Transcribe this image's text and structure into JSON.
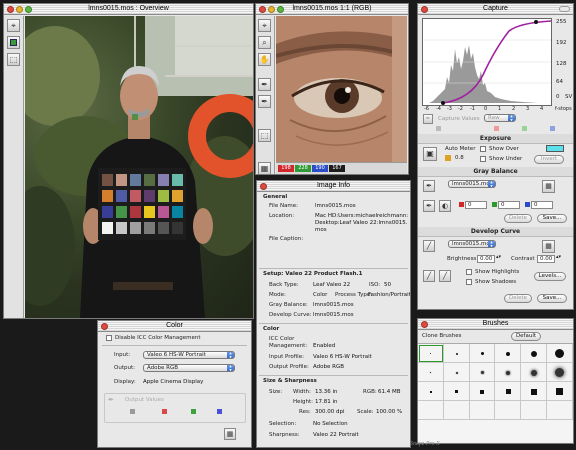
{
  "overview": {
    "title": "lmns0015.mos : Overview",
    "tools": [
      "crosshair-icon",
      "color-square-icon",
      "crop-icon"
    ]
  },
  "loupe": {
    "title": "lmns0015.mos 1:1 (RGB)",
    "rgb": {
      "r": "198",
      "g": "228",
      "b": "190",
      "extra": "167"
    },
    "tools": [
      "crosshair-icon",
      "zoom-icon",
      "hand-icon",
      "eyedropper-icon",
      "gray-eyedropper-icon",
      "crop-icon",
      "grid-icon"
    ]
  },
  "capture": {
    "title": "Capture",
    "axis_right": [
      "255",
      "192",
      "128",
      "64",
      "0"
    ],
    "sv_label": "SV",
    "axis_bottom": [
      "-6",
      "-4",
      "-3",
      "-2",
      "-1",
      "0",
      "1",
      "2",
      "3",
      "4"
    ],
    "fstops_label": "f-stops",
    "values_label": "Capture Values",
    "raw_option": "Raw"
  },
  "exposure": {
    "title": "Exposure",
    "auto_meter_label": "Auto Meter",
    "auto_meter_value": "0.8",
    "show_over_label": "Show Over",
    "show_under_label": "Show Under",
    "invert_label": "Invert",
    "over_color": "#5ce0ec"
  },
  "gray_balance": {
    "title": "Gray Balance",
    "preset": "lmns0015.mos",
    "r_value": "0",
    "g_value": "0",
    "b_value": "0",
    "delete_label": "Delete",
    "save_label": "Save..."
  },
  "develop_curve": {
    "title": "Develop Curve",
    "preset": "lmns0015.mos",
    "brightness_label": "Brightness",
    "brightness_value": "0.00",
    "contrast_label": "Contrast",
    "contrast_value": "0.00",
    "show_highlights_label": "Show Highlights",
    "show_shadows_label": "Show Shadows",
    "levels_label": "Levels...",
    "delete_label": "Delete",
    "save_label": "Save..."
  },
  "brushes": {
    "title": "Brushes",
    "clone_label": "Clone Brushes",
    "default_label": "Default"
  },
  "image_info": {
    "title": "Image Info",
    "general_header": "General",
    "file_name_label": "File Name:",
    "file_name": "lmns0015.mos",
    "location_label": "Location:",
    "location": "Mac HD:Users:michaelreichmann:Desktop:Leaf Valeo 22:lmns0015.mos",
    "caption_label": "File Caption:",
    "setup_header": "Setup:  Valeo 22 Product Flash.1",
    "back_type_label": "Back Type:",
    "back_type": "Leaf Valeo 22",
    "iso_label": "ISO:",
    "iso": "50",
    "mode_label": "Mode:",
    "mode": "Color",
    "process_label": "Process Type:",
    "process": "Fashion/Portrait",
    "gray_balance_label": "Gray Balance:",
    "gray_balance": "lmns0015.mos",
    "develop_curve_label": "Develop Curve:",
    "develop_curve": "lmns0015.mos",
    "color_header": "Color",
    "icc_label": "ICC Color Management:",
    "icc": "Enabled",
    "input_profile_label": "Input Profile:",
    "input_profile": "Valeo 6 HS-W Portrait",
    "output_profile_label": "Output Profile:",
    "output_profile": "Adobe RGB",
    "size_header": "Size & Sharpness",
    "size_label": "Size:",
    "width_label": "Width:",
    "width": "13.36 in",
    "rgb_label": "RGB:",
    "rgb": "61.4 MB",
    "height_label": "Height:",
    "height": "17.81 in",
    "res_label": "Res:",
    "res": "300.00 dpi",
    "scale_label": "Scale:",
    "scale": "100.00 %",
    "selection_label": "Selection:",
    "selection": "No Selection",
    "sharpness_label": "Sharpness:",
    "sharpness": "Valeo 22 Portrait"
  },
  "color_panel": {
    "title": "Color",
    "disable_icc_label": "Disable ICC Color Management",
    "input_label": "Input:",
    "input_value": "Valeo 6 HS-W Portrait",
    "output_label": "Output:",
    "output_value": "Adobe RGB",
    "display_label": "Display:",
    "display_value": "Apple Cinema Display",
    "output_values_label": "Output Values"
  },
  "watermark": "Snapz Pro X"
}
